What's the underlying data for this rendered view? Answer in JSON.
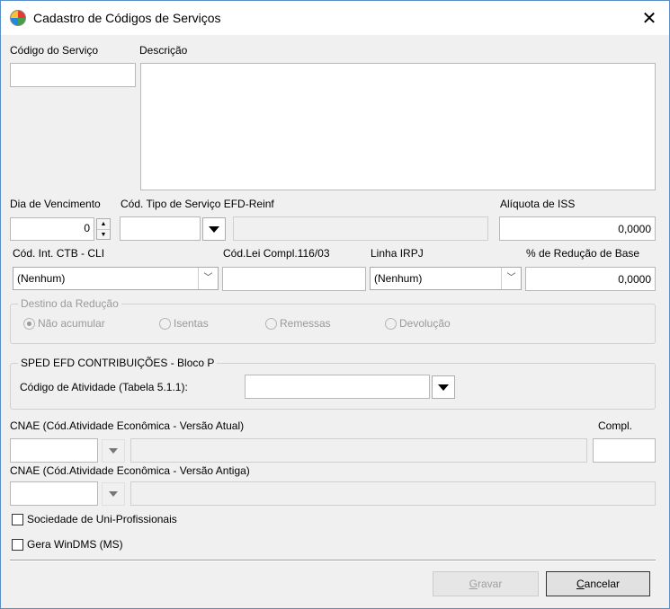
{
  "window": {
    "title": "Cadastro de Códigos de Serviços",
    "close_glyph": "✕"
  },
  "labels": {
    "codigo_servico": "Código do Serviço",
    "descricao": "Descrição",
    "dia_vencimento": "Dia de Vencimento",
    "cod_tipo_servico": "Cód. Tipo de Serviço EFD-Reinf",
    "aliquota_iss": "Alíquota de ISS",
    "cod_int_ctb": "Cód. Int. CTB - CLI",
    "cod_lei_compl": "Cód.Lei Compl.116/03",
    "linha_irpj": "Linha IRPJ",
    "pct_reducao": "% de Redução de Base",
    "cnae_atual": "CNAE (Cód.Atividade Econômica - Versão Atual)",
    "compl": "Compl.",
    "cnae_antiga": "CNAE (Cód.Atividade Econômica - Versão Antiga)"
  },
  "values": {
    "codigo_servico": "",
    "descricao": "",
    "dia_vencimento": "0",
    "cod_tipo_servico": "",
    "aliquota_iss": "0,0000",
    "cod_int_ctb": "(Nenhum)",
    "cod_lei_compl": "",
    "linha_irpj": "(Nenhum)",
    "pct_reducao": "0,0000",
    "codigo_atividade": "",
    "cnae_atual": "",
    "compl": "",
    "cnae_antiga": ""
  },
  "destino_reducao": {
    "legend": "Destino da Redução",
    "options": [
      "Não acumular",
      "Isentas",
      "Remessas",
      "Devolução"
    ],
    "selected": "Não acumular"
  },
  "sped": {
    "legend": "SPED EFD CONTRIBUIÇÕES - Bloco P",
    "codigo_atividade_label": "Código de Atividade (Tabela 5.1.1):"
  },
  "checkboxes": {
    "sociedade": {
      "label": "Sociedade de Uni-Profissionais",
      "checked": false
    },
    "gera_windms": {
      "label": "Gera WinDMS (MS)",
      "checked": false
    }
  },
  "buttons": {
    "gravar_first": "G",
    "gravar_rest": "ravar",
    "cancelar_first": "C",
    "cancelar_rest": "ancelar"
  }
}
